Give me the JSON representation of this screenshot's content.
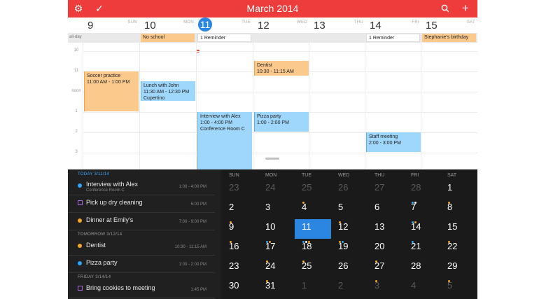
{
  "topbar": {
    "title": "March 2014",
    "settings_icon": "gear-icon",
    "check_icon": "checkmark-icon",
    "search_icon": "search-icon",
    "add_icon": "plus-icon",
    "color": "#ee3b3b"
  },
  "week_days": [
    {
      "num": "9",
      "name": "SUN"
    },
    {
      "num": "10",
      "name": "MON"
    },
    {
      "num": "11",
      "name": "TUE",
      "today": true
    },
    {
      "num": "12",
      "name": "WED"
    },
    {
      "num": "13",
      "name": "THU"
    },
    {
      "num": "14",
      "name": "FRI"
    },
    {
      "num": "15",
      "name": "SAT"
    }
  ],
  "allday": {
    "label": "all-day",
    "events": [
      {
        "text": "No school",
        "col": 1,
        "style": "orange"
      },
      {
        "text": "1 Reminder",
        "col": 2,
        "style": "white"
      },
      {
        "text": "1 Reminder",
        "col": 5,
        "style": "white"
      },
      {
        "text": "Stephanie's birthday",
        "col": 6,
        "style": "orange"
      }
    ]
  },
  "hour_labels": [
    "10",
    "11",
    "noon",
    "1",
    "2",
    "3"
  ],
  "events": [
    {
      "title": "Soccer practice",
      "time": "11:00 AM - 1:00 PM",
      "loc": "",
      "col": 0,
      "start": 11.0,
      "end": 13.0,
      "style": "orange"
    },
    {
      "title": "Lunch with John",
      "time": "11:30 AM - 12:30 PM",
      "loc": "Cupertino",
      "col": 1,
      "start": 11.5,
      "end": 12.5,
      "style": "blue"
    },
    {
      "title": "Interview with Alex",
      "time": "1:00 - 4:00 PM",
      "loc": "Conference Room C",
      "col": 2,
      "start": 13.0,
      "end": 16.0,
      "style": "blue"
    },
    {
      "title": "Dentist",
      "time": "10:30 - 11:15 AM",
      "loc": "",
      "col": 3,
      "start": 10.5,
      "end": 11.25,
      "style": "orange"
    },
    {
      "title": "Pizza party",
      "time": "1:00 - 2:00 PM",
      "loc": "",
      "col": 3,
      "start": 13.0,
      "end": 14.0,
      "style": "blue"
    },
    {
      "title": "Staff meeting",
      "time": "2:00 - 3:00 PM",
      "loc": "",
      "col": 5,
      "start": 14.0,
      "end": 15.0,
      "style": "blue"
    }
  ],
  "agenda": {
    "sections": [
      {
        "header": "TODAY 3/11/14",
        "today": true,
        "items": [
          {
            "title": "Interview with Alex",
            "sub": "Conference Room C",
            "time": "1:00 - 4:00 PM",
            "kind": "dot",
            "color": "#2aa7ff"
          },
          {
            "title": "Pick up dry cleaning",
            "sub": "",
            "time": "5:00 PM",
            "kind": "square",
            "color": "#b06ae0"
          },
          {
            "title": "Dinner at Emily's",
            "sub": "",
            "time": "7:00 - 9:00 PM",
            "kind": "dot",
            "color": "#f5a623"
          }
        ]
      },
      {
        "header": "TOMORROW 3/12/14",
        "today": false,
        "items": [
          {
            "title": "Dentist",
            "sub": "",
            "time": "10:30 - 11:15 AM",
            "kind": "dot",
            "color": "#f5a623"
          },
          {
            "title": "Pizza party",
            "sub": "",
            "time": "1:00 - 2:00 PM",
            "kind": "dot",
            "color": "#2aa7ff"
          }
        ]
      },
      {
        "header": "FRIDAY 3/14/14",
        "today": false,
        "items": [
          {
            "title": "Bring cookies to meeting",
            "sub": "",
            "time": "1:45 PM",
            "kind": "square",
            "color": "#b06ae0"
          }
        ]
      }
    ]
  },
  "month": {
    "weekdays": [
      "SUN",
      "MON",
      "TUE",
      "WED",
      "THU",
      "FRI",
      "SAT"
    ],
    "weeks": [
      [
        {
          "n": "23",
          "dim": true
        },
        {
          "n": "24",
          "dim": true
        },
        {
          "n": "25",
          "dim": true,
          "dots": [
            "#f5a623"
          ]
        },
        {
          "n": "26",
          "dim": true
        },
        {
          "n": "27",
          "dim": true
        },
        {
          "n": "28",
          "dim": true,
          "dots": [
            "#2aa7ff",
            "#fff"
          ]
        },
        {
          "n": "1",
          "dots": [
            "#f5a623"
          ]
        }
      ],
      [
        {
          "n": "2",
          "dots": [
            "#f5a623"
          ]
        },
        {
          "n": "3"
        },
        {
          "n": "4",
          "dots": [
            "#f5a623"
          ]
        },
        {
          "n": "5",
          "dots": [
            "#f5a623"
          ]
        },
        {
          "n": "6"
        },
        {
          "n": "7",
          "dots": [
            "#2aa7ff",
            "#f5a623"
          ]
        },
        {
          "n": "8"
        }
      ],
      [
        {
          "n": "9",
          "dots": [
            "#f5a623"
          ]
        },
        {
          "n": "10",
          "dots": [
            "#2aa7ff",
            "#f5a623"
          ]
        },
        {
          "n": "11",
          "selected": true,
          "dots": [
            "#2aa7ff",
            "#fff",
            "#f5a623"
          ]
        },
        {
          "n": "12",
          "dots": [
            "#f5a623",
            "#2aa7ff"
          ]
        },
        {
          "n": "13"
        },
        {
          "n": "14",
          "dots": [
            "#2aa7ff"
          ]
        },
        {
          "n": "15",
          "dots": [
            "#f5a623"
          ]
        }
      ],
      [
        {
          "n": "16"
        },
        {
          "n": "17",
          "dots": [
            "#f5a623"
          ]
        },
        {
          "n": "18",
          "dots": [
            "#f5a623"
          ]
        },
        {
          "n": "19"
        },
        {
          "n": "20",
          "dots": [
            "#f5a623"
          ]
        },
        {
          "n": "21"
        },
        {
          "n": "22"
        }
      ],
      [
        {
          "n": "23"
        },
        {
          "n": "24",
          "dots": [
            "#f5a623"
          ]
        },
        {
          "n": "25"
        },
        {
          "n": "26"
        },
        {
          "n": "27",
          "dots": [
            "#f5a623"
          ]
        },
        {
          "n": "28"
        },
        {
          "n": "29",
          "dots": [
            "#f5a623"
          ]
        }
      ],
      [
        {
          "n": "30"
        },
        {
          "n": "31",
          "dots": [
            "#f5a623"
          ]
        },
        {
          "n": "1",
          "dim": true
        },
        {
          "n": "2",
          "dim": true
        },
        {
          "n": "3",
          "dim": true
        },
        {
          "n": "4",
          "dim": true
        },
        {
          "n": "5",
          "dim": true,
          "dots": [
            "#f5a623"
          ]
        }
      ]
    ]
  }
}
